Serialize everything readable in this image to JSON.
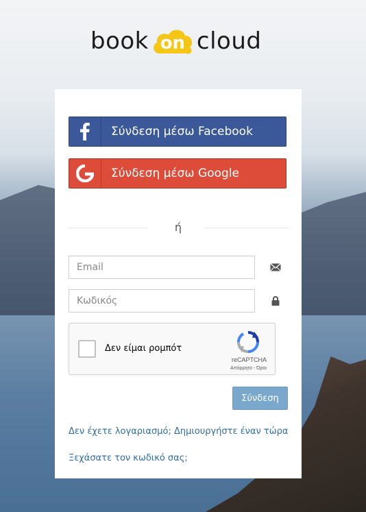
{
  "logo": {
    "left": "book",
    "middle": "on",
    "right": "cloud"
  },
  "social": {
    "facebook_label": "Σύνδεση μέσω Facebook",
    "google_label": "Σύνδεση μέσω Google"
  },
  "divider": {
    "text": "ή"
  },
  "form": {
    "email_placeholder": "Email",
    "password_placeholder": "Κωδικός",
    "submit_label": "Σύνδεση"
  },
  "recaptcha": {
    "label": "Δεν είμαι ρομπότ",
    "brand": "reCAPTCHA",
    "links": "Απόρρητο - Όροι"
  },
  "links": {
    "create_account": "Δεν έχετε λογαριασμό; Δημιουργήστε έναν τώρα",
    "forgot_password": "Ξεχάσατε τον κωδικό σας;"
  },
  "colors": {
    "facebook": "#3b5998",
    "google": "#dd4b39",
    "submit": "#7aa7cc",
    "link": "#2e6da4",
    "logo_accent": "#f5c518"
  },
  "icons": {
    "facebook": "facebook-icon",
    "google": "google-icon",
    "email": "envelope-icon",
    "password": "lock-icon",
    "recaptcha": "recaptcha-icon"
  }
}
